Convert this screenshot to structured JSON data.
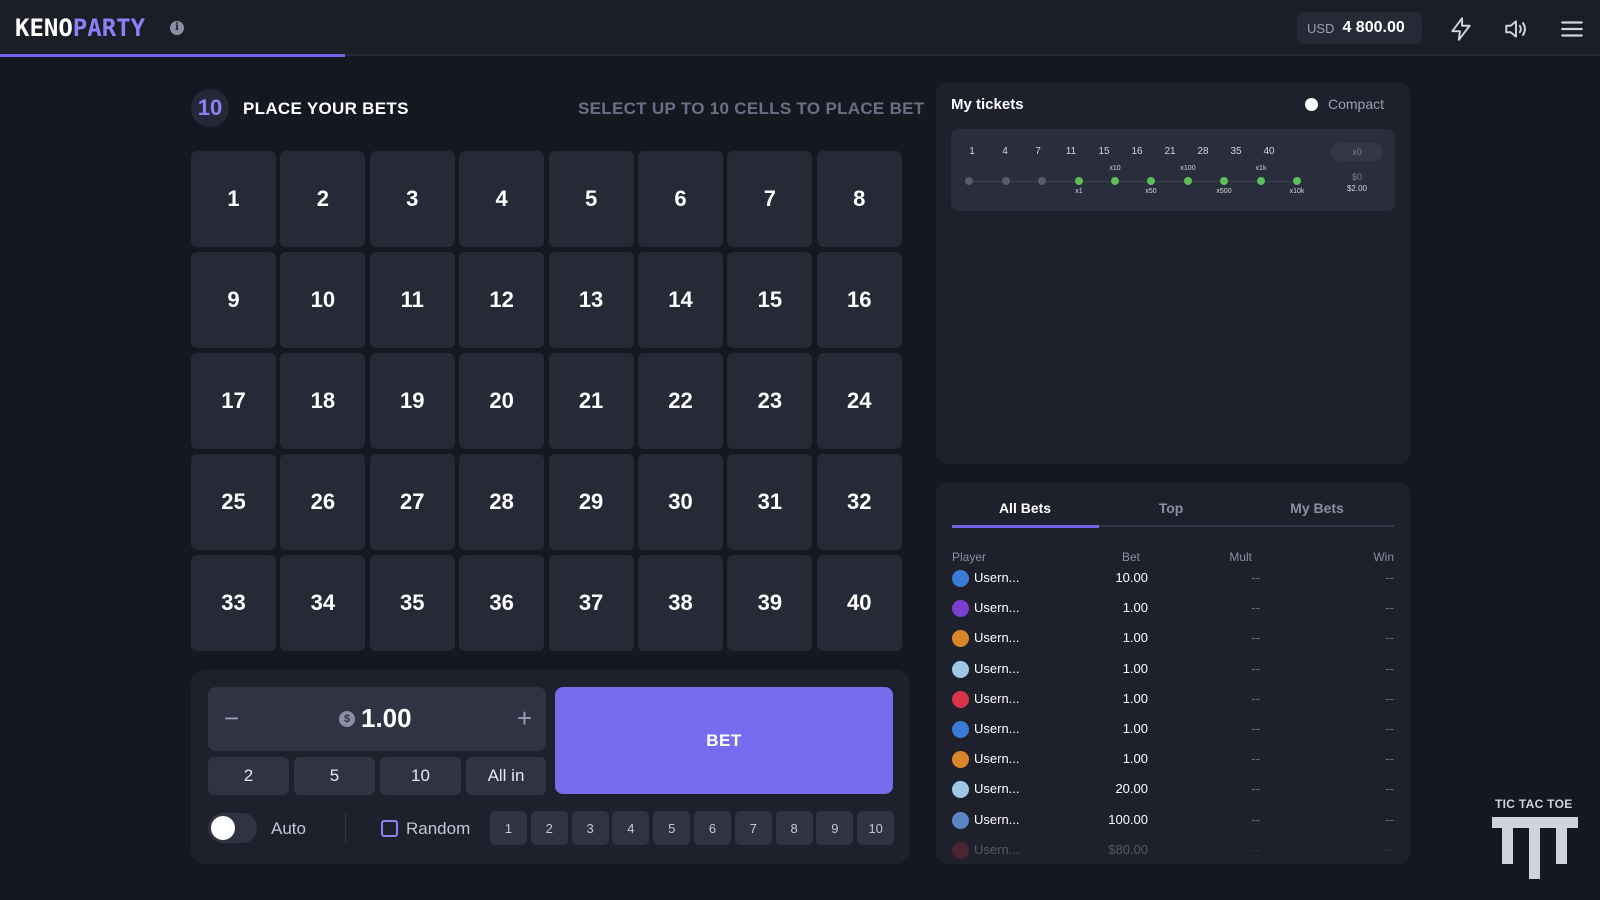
{
  "header": {
    "logo_part1": "KENO",
    "logo_part2": "PARTY",
    "info_icon": "info-icon",
    "balance_currency": "USD",
    "balance_amount": "4 800.00",
    "icons": [
      "lightning-icon",
      "sound-icon",
      "menu-icon"
    ],
    "accent_color": "#7166ea"
  },
  "board": {
    "round_number": "10",
    "title": "PLACE YOUR BETS",
    "hint": "SELECT UP TO 10 CELLS TO PLACE BET",
    "cells": [
      "1",
      "2",
      "3",
      "4",
      "5",
      "6",
      "7",
      "8",
      "9",
      "10",
      "11",
      "12",
      "13",
      "14",
      "15",
      "16",
      "17",
      "18",
      "19",
      "20",
      "21",
      "22",
      "23",
      "24",
      "25",
      "26",
      "27",
      "28",
      "29",
      "30",
      "31",
      "32",
      "33",
      "34",
      "35",
      "36",
      "37",
      "38",
      "39",
      "40"
    ]
  },
  "bet_panel": {
    "minus": "−",
    "plus": "+",
    "currency_symbol": "$",
    "amount": "1.00",
    "quick_amounts": [
      "2",
      "5",
      "10",
      "All in"
    ],
    "bet_label": "BET",
    "auto_label": "Auto",
    "auto_enabled": false,
    "random_label": "Random",
    "random_counts": [
      "1",
      "2",
      "3",
      "4",
      "5",
      "6",
      "7",
      "8",
      "9",
      "10"
    ]
  },
  "tickets": {
    "title": "My tickets",
    "compact_label": "Compact",
    "ticket": {
      "numbers": [
        "1",
        "4",
        "7",
        "11",
        "15",
        "16",
        "21",
        "28",
        "35",
        "40"
      ],
      "multipliers_below": [
        "x1",
        "x50",
        "x500",
        "x10k"
      ],
      "multipliers_above": [
        "x10",
        "x100",
        "x1k"
      ],
      "result": "x0",
      "win": "$0",
      "stake": "$2.00"
    }
  },
  "bets": {
    "tabs": [
      "All Bets",
      "Top",
      "My Bets"
    ],
    "active_tab": "All Bets",
    "columns": [
      "Player",
      "Bet",
      "Mult",
      "Win"
    ],
    "rows": [
      {
        "player": "Usern...",
        "bet": "10.00",
        "mult": "--",
        "win": "--",
        "avatar_color": "#3a7bd5"
      },
      {
        "player": "Usern...",
        "bet": "1.00",
        "mult": "--",
        "win": "--",
        "avatar_color": "#7a3fd0"
      },
      {
        "player": "Usern...",
        "bet": "1.00",
        "mult": "--",
        "win": "--",
        "avatar_color": "#d9852b"
      },
      {
        "player": "Usern...",
        "bet": "1.00",
        "mult": "--",
        "win": "--",
        "avatar_color": "#9fc7e6"
      },
      {
        "player": "Usern...",
        "bet": "1.00",
        "mult": "--",
        "win": "--",
        "avatar_color": "#d8344a"
      },
      {
        "player": "Usern...",
        "bet": "1.00",
        "mult": "--",
        "win": "--",
        "avatar_color": "#3a7bd5"
      },
      {
        "player": "Usern...",
        "bet": "1.00",
        "mult": "--",
        "win": "--",
        "avatar_color": "#d9852b"
      },
      {
        "player": "Usern...",
        "bet": "20.00",
        "mult": "--",
        "win": "--",
        "avatar_color": "#9fc7e6"
      },
      {
        "player": "Usern...",
        "bet": "100.00",
        "mult": "--",
        "win": "--",
        "avatar_color": "#5b86c4"
      },
      {
        "player": "Usern...",
        "bet": "$80.00",
        "mult": "--",
        "win": "--",
        "avatar_color": "#d8344a"
      }
    ]
  },
  "provider": {
    "label": "TIC TAC TOE"
  }
}
